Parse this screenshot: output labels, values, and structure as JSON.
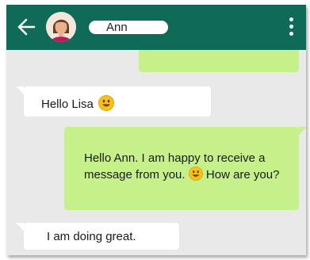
{
  "colors": {
    "header": "#0f6b57",
    "chat_background": "#e9e9e9",
    "outgoing_bubble": "#c6f08a",
    "incoming_bubble": "#ffffff"
  },
  "header": {
    "back_icon": "arrow-left-icon",
    "contact_name": "Ann",
    "menu_icon": "vertical-dots-icon"
  },
  "messages": {
    "msg1": {
      "direction": "incoming",
      "text": "Hello Lisa",
      "emoji": "smiley"
    },
    "msg2": {
      "direction": "outgoing",
      "text_before": "Hello Ann. I am happy to receive a message from you.",
      "emoji": "smiley",
      "text_after": "How are you?"
    },
    "msg3": {
      "direction": "incoming",
      "text": "I am doing great."
    }
  }
}
